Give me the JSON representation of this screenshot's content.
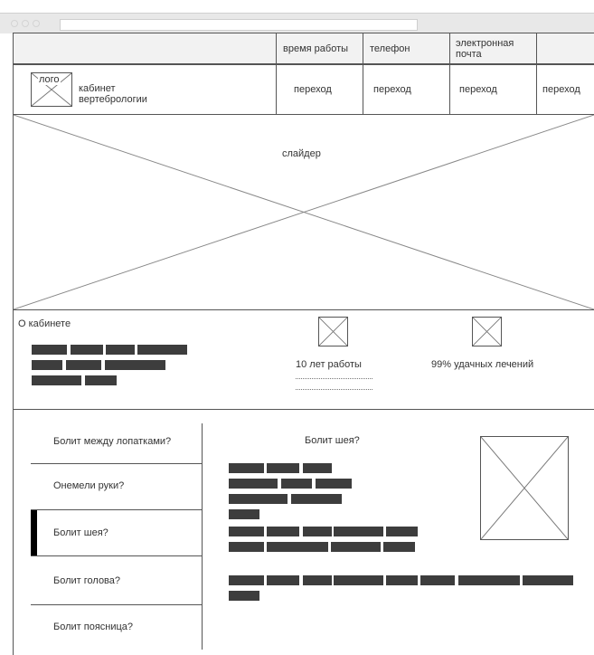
{
  "header": {
    "columns": [
      "время работы",
      "телефон",
      "электронная почта"
    ]
  },
  "nav": {
    "logo_label": "лого",
    "title": "кабинет вертебрологии",
    "links": [
      "переход",
      "переход",
      "переход",
      "переход"
    ]
  },
  "slider": {
    "label": "слайдер"
  },
  "about": {
    "title": "О кабинете",
    "stat1": "10 лет работы",
    "stat2": "99% удачных лечений"
  },
  "faq": {
    "items": [
      "Болит между лопатками?",
      "Онемели руки?",
      "Болит шея?",
      "Болит голова?",
      "Болит поясница?"
    ],
    "active_index": 2,
    "detail_title": "Болит шея?"
  },
  "colors": {
    "chrome": "#e8e8e8",
    "header_bg": "#f2f2f2",
    "line": "#555555",
    "bar": "#3d3d3d",
    "active_marker": "#000000"
  }
}
